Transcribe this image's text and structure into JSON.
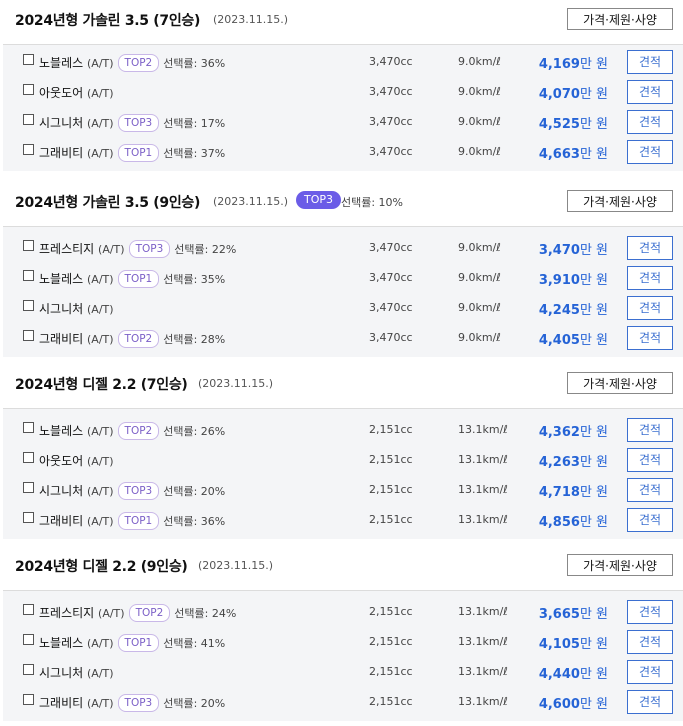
{
  "sections": [
    {
      "title": "2024년형 가솔린 3.5 (7인승)",
      "date": "(2023.11.15.)",
      "spec_label": "가격·제원·사양",
      "rows": [
        {
          "trim": "노블레스",
          "trans": "(A/T)",
          "tag": "TOP2",
          "rate": "선택률: 36%",
          "cc": "3,470cc",
          "eff": "9.0km/ℓ",
          "price": "4,169",
          "unit": "만 원",
          "quote": "견적"
        },
        {
          "trim": "아웃도어",
          "trans": "(A/T)",
          "tag": "",
          "rate": "",
          "cc": "3,470cc",
          "eff": "9.0km/ℓ",
          "price": "4,070",
          "unit": "만 원",
          "quote": "견적"
        },
        {
          "trim": "시그니처",
          "trans": "(A/T)",
          "tag": "TOP3",
          "rate": "선택률: 17%",
          "cc": "3,470cc",
          "eff": "9.0km/ℓ",
          "price": "4,525",
          "unit": "만 원",
          "quote": "견적"
        },
        {
          "trim": "그래비티",
          "trans": "(A/T)",
          "tag": "TOP1",
          "rate": "선택률: 37%",
          "cc": "3,470cc",
          "eff": "9.0km/ℓ",
          "price": "4,663",
          "unit": "만 원",
          "quote": "견적"
        }
      ]
    },
    {
      "title": "2024년형 가솔린 3.5 (9인승)",
      "date": "(2023.11.15.)",
      "badge": "TOP3",
      "badge_rate": "선택률: 10%",
      "spec_label": "가격·제원·사양",
      "rows": [
        {
          "trim": "프레스티지",
          "trans": "(A/T)",
          "tag": "TOP3",
          "rate": "선택률: 22%",
          "cc": "3,470cc",
          "eff": "9.0km/ℓ",
          "price": "3,470",
          "unit": "만 원",
          "quote": "견적"
        },
        {
          "trim": "노블레스",
          "trans": "(A/T)",
          "tag": "TOP1",
          "rate": "선택률: 35%",
          "cc": "3,470cc",
          "eff": "9.0km/ℓ",
          "price": "3,910",
          "unit": "만 원",
          "quote": "견적"
        },
        {
          "trim": "시그니처",
          "trans": "(A/T)",
          "tag": "",
          "rate": "",
          "cc": "3,470cc",
          "eff": "9.0km/ℓ",
          "price": "4,245",
          "unit": "만 원",
          "quote": "견적"
        },
        {
          "trim": "그래비티",
          "trans": "(A/T)",
          "tag": "TOP2",
          "rate": "선택률: 28%",
          "cc": "3,470cc",
          "eff": "9.0km/ℓ",
          "price": "4,405",
          "unit": "만 원",
          "quote": "견적"
        }
      ]
    },
    {
      "title": "2024년형 디젤 2.2 (7인승)",
      "date": "(2023.11.15.)",
      "spec_label": "가격·제원·사양",
      "rows": [
        {
          "trim": "노블레스",
          "trans": "(A/T)",
          "tag": "TOP2",
          "rate": "선택률: 26%",
          "cc": "2,151cc",
          "eff": "13.1km/ℓ",
          "price": "4,362",
          "unit": "만 원",
          "quote": "견적"
        },
        {
          "trim": "아웃도어",
          "trans": "(A/T)",
          "tag": "",
          "rate": "",
          "cc": "2,151cc",
          "eff": "13.1km/ℓ",
          "price": "4,263",
          "unit": "만 원",
          "quote": "견적"
        },
        {
          "trim": "시그니처",
          "trans": "(A/T)",
          "tag": "TOP3",
          "rate": "선택률: 20%",
          "cc": "2,151cc",
          "eff": "13.1km/ℓ",
          "price": "4,718",
          "unit": "만 원",
          "quote": "견적"
        },
        {
          "trim": "그래비티",
          "trans": "(A/T)",
          "tag": "TOP1",
          "rate": "선택률: 36%",
          "cc": "2,151cc",
          "eff": "13.1km/ℓ",
          "price": "4,856",
          "unit": "만 원",
          "quote": "견적"
        }
      ]
    },
    {
      "title": "2024년형 디젤 2.2 (9인승)",
      "date": "(2023.11.15.)",
      "spec_label": "가격·제원·사양",
      "rows": [
        {
          "trim": "프레스티지",
          "trans": "(A/T)",
          "tag": "TOP2",
          "rate": "선택률: 24%",
          "cc": "2,151cc",
          "eff": "13.1km/ℓ",
          "price": "3,665",
          "unit": "만 원",
          "quote": "견적"
        },
        {
          "trim": "노블레스",
          "trans": "(A/T)",
          "tag": "TOP1",
          "rate": "선택률: 41%",
          "cc": "2,151cc",
          "eff": "13.1km/ℓ",
          "price": "4,105",
          "unit": "만 원",
          "quote": "견적"
        },
        {
          "trim": "시그니처",
          "trans": "(A/T)",
          "tag": "",
          "rate": "",
          "cc": "2,151cc",
          "eff": "13.1km/ℓ",
          "price": "4,440",
          "unit": "만 원",
          "quote": "견적"
        },
        {
          "trim": "그래비티",
          "trans": "(A/T)",
          "tag": "TOP3",
          "rate": "선택률: 20%",
          "cc": "2,151cc",
          "eff": "13.1km/ℓ",
          "price": "4,600",
          "unit": "만 원",
          "quote": "견적"
        }
      ]
    }
  ]
}
